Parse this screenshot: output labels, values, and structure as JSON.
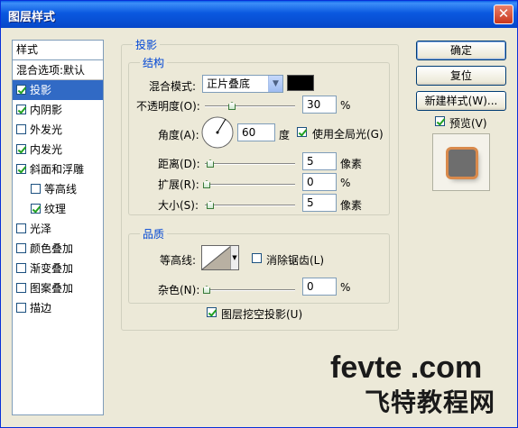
{
  "window": {
    "title": "图层样式",
    "close_glyph": "✕"
  },
  "stylelist": {
    "header": "样式",
    "items": [
      {
        "label": "混合选项:默认",
        "checkbox": false,
        "checked": false
      },
      {
        "label": "投影",
        "checkbox": true,
        "checked": true,
        "selected": true
      },
      {
        "label": "内阴影",
        "checkbox": true,
        "checked": true
      },
      {
        "label": "外发光",
        "checkbox": true,
        "checked": false
      },
      {
        "label": "内发光",
        "checkbox": true,
        "checked": true
      },
      {
        "label": "斜面和浮雕",
        "checkbox": true,
        "checked": true
      },
      {
        "label": "等高线",
        "checkbox": true,
        "checked": false,
        "indent": true
      },
      {
        "label": "纹理",
        "checkbox": true,
        "checked": true,
        "indent": true
      },
      {
        "label": "光泽",
        "checkbox": true,
        "checked": false
      },
      {
        "label": "颜色叠加",
        "checkbox": true,
        "checked": false
      },
      {
        "label": "渐变叠加",
        "checkbox": true,
        "checked": false
      },
      {
        "label": "图案叠加",
        "checkbox": true,
        "checked": false
      },
      {
        "label": "描边",
        "checkbox": true,
        "checked": false
      }
    ]
  },
  "shadow": {
    "section_title": "投影",
    "structure_title": "结构",
    "blend_mode_label": "混合模式:",
    "blend_mode_value": "正片叠底",
    "blend_color": "#000000",
    "opacity_label": "不透明度(O):",
    "opacity_value": "30",
    "opacity_unit": "%",
    "angle_label": "角度(A):",
    "angle_value": "60",
    "angle_unit": "度",
    "global_light_label": "使用全局光(G)",
    "global_light_checked": true,
    "distance_label": "距离(D):",
    "distance_value": "5",
    "distance_unit": "像素",
    "spread_label": "扩展(R):",
    "spread_value": "0",
    "spread_unit": "%",
    "size_label": "大小(S):",
    "size_value": "5",
    "size_unit": "像素"
  },
  "quality": {
    "title": "品质",
    "contour_label": "等高线:",
    "antialias_label": "消除锯齿(L)",
    "antialias_checked": false,
    "noise_label": "杂色(N):",
    "noise_value": "0",
    "noise_unit": "%",
    "knockout_label": "图层挖空投影(U)",
    "knockout_checked": true
  },
  "buttons": {
    "ok": "确定",
    "reset": "复位",
    "new_style": "新建样式(W)...",
    "preview_label": "预览(V)",
    "preview_checked": true
  },
  "watermark": {
    "line1": "fevte .com",
    "line2": "飞特教程网"
  }
}
